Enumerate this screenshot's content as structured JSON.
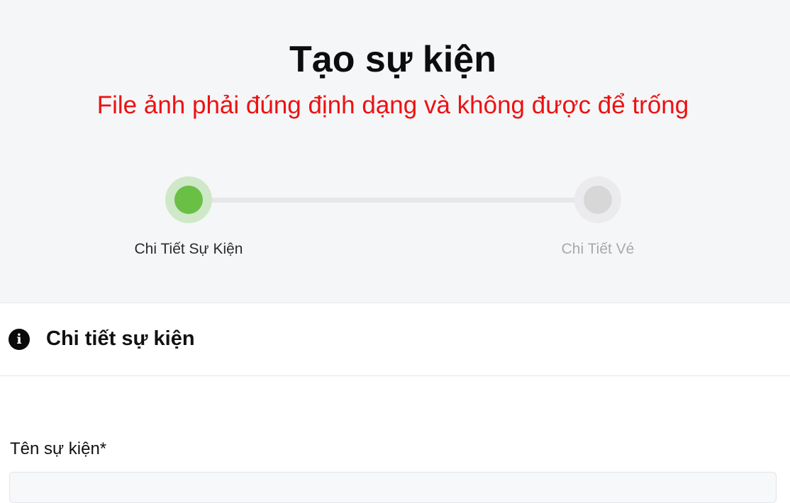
{
  "header": {
    "title": "Tạo sự kiện",
    "error_message": "File ảnh phải đúng định dạng và không được để trống"
  },
  "stepper": {
    "steps": [
      {
        "label": "Chi Tiết Sự Kiện",
        "state": "active"
      },
      {
        "label": "Chi Tiết Vé",
        "state": "inactive"
      }
    ],
    "colors": {
      "active": "#6abf45",
      "active_halo": "#cfe8c8",
      "inactive": "#d7d7d7",
      "inactive_halo": "#ebebed"
    }
  },
  "section": {
    "icon": "info-circle-icon",
    "title": "Chi tiết sự kiện"
  },
  "form": {
    "event_name": {
      "label": "Tên sự kiện*",
      "value": ""
    }
  }
}
